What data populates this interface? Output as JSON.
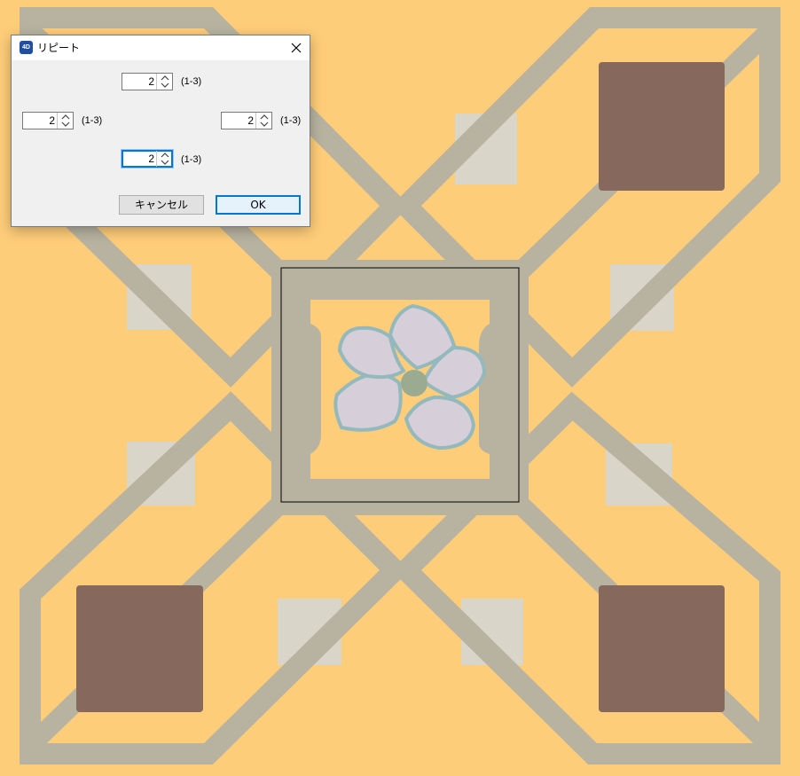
{
  "dialog": {
    "title": "リピート",
    "app_icon_text": "4D",
    "top": {
      "value": "2",
      "range": "(1-3)"
    },
    "left": {
      "value": "2",
      "range": "(1-3)"
    },
    "right": {
      "value": "2",
      "range": "(1-3)"
    },
    "bottom": {
      "value": "2",
      "range": "(1-3)"
    },
    "cancel_label": "キャンセル",
    "ok_label": "OK"
  },
  "colors": {
    "background": "#fecd79",
    "band": "#b8b3a0",
    "light_patch": "#d9d5c8",
    "brown": "#87685c",
    "petal": "#d6cfd9",
    "petal_outline": "#93b9bd",
    "flower_center": "#9aab91"
  },
  "icons": {
    "close": "close-icon",
    "spinner": "spinner-arrows-icon",
    "app": "app-icon"
  }
}
